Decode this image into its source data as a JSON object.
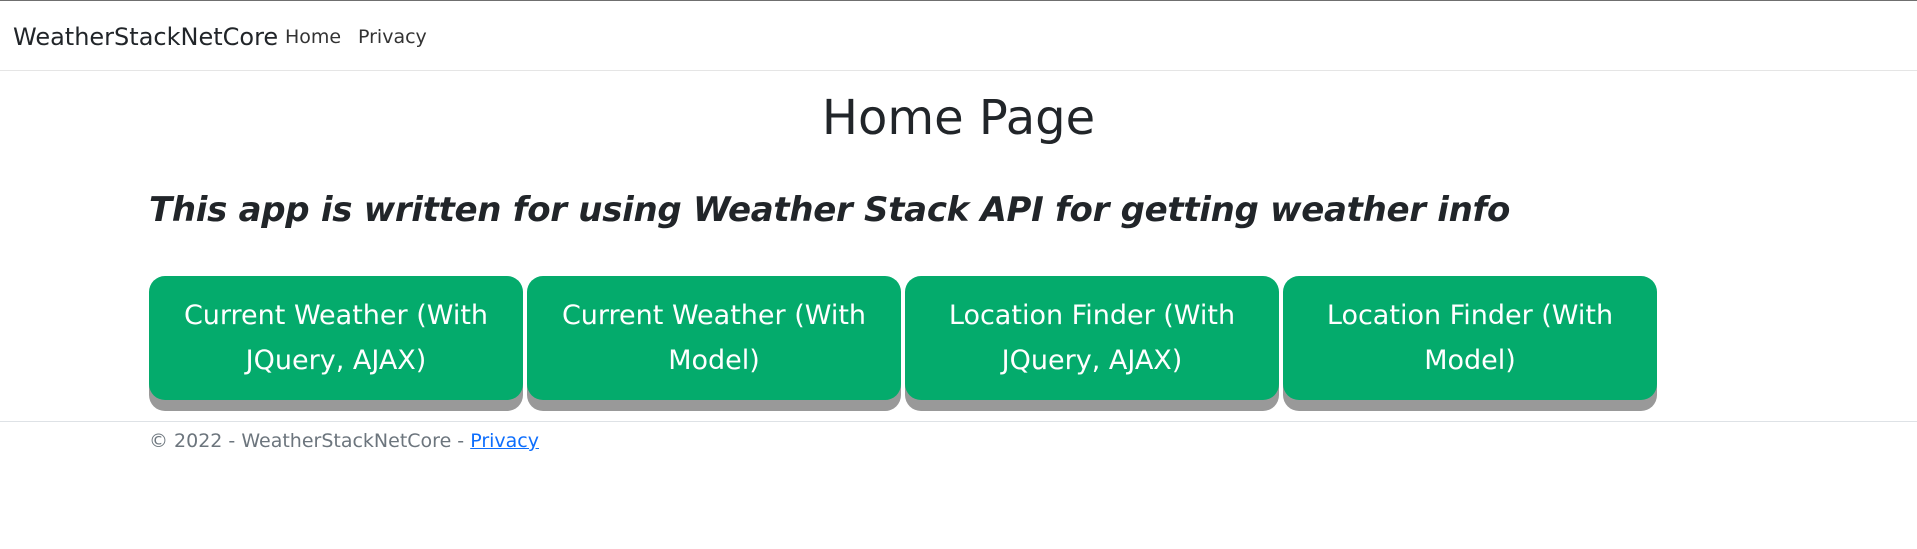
{
  "navbar": {
    "brand": "WeatherStackNetCore",
    "links": [
      {
        "label": "Home"
      },
      {
        "label": "Privacy"
      }
    ]
  },
  "main": {
    "title": "Home Page",
    "subtitle": "This app is written for using Weather Stack API for getting weather info",
    "buttons": [
      {
        "label": "Current Weather (With JQuery, AJAX)"
      },
      {
        "label": "Current Weather (With Model)"
      },
      {
        "label": "Location Finder (With JQuery, AJAX)"
      },
      {
        "label": "Location Finder (With Model)"
      }
    ]
  },
  "footer": {
    "copyright": "© 2022 - WeatherStackNetCore - ",
    "privacy_link": "Privacy"
  },
  "colors": {
    "button_bg": "#04ab6c",
    "button_shadow": "#999999",
    "link": "#0d6efd",
    "text": "#212529",
    "muted": "#6c757d"
  }
}
